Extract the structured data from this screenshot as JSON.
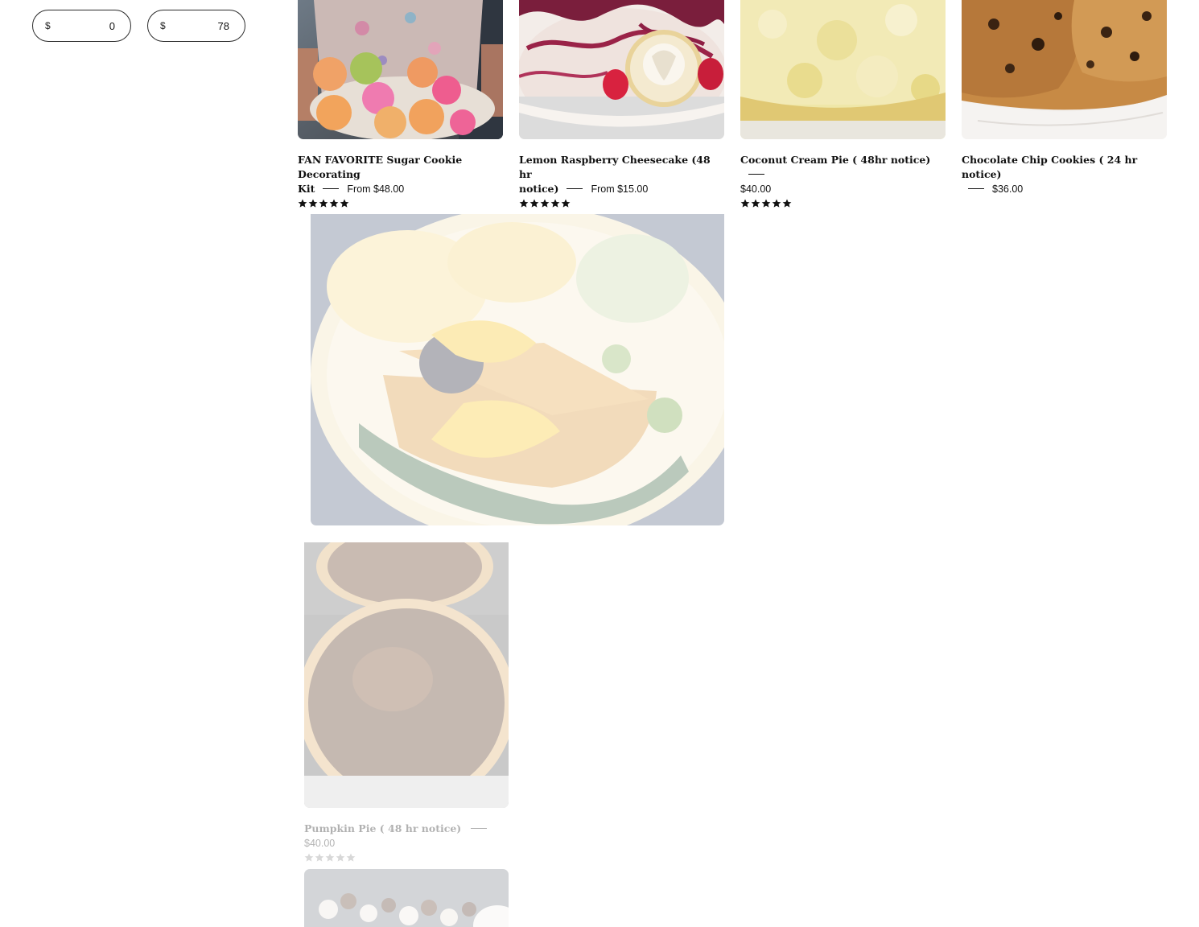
{
  "filter": {
    "currency_symbol": "$",
    "min_value": "0",
    "max_value": "78"
  },
  "products": [
    {
      "title": "FAN FAVORITE Sugar Cookie Decorating",
      "title2": "Kit",
      "price": "From $48.00",
      "rating": 5
    },
    {
      "title": "Lemon Raspberry Cheesecake (48 hr",
      "title2": "notice)",
      "price": "From $15.00",
      "rating": 5
    },
    {
      "title": "Coconut Cream Pie ( 48hr notice)",
      "title2": "",
      "price": "$40.00",
      "rating": 5
    },
    {
      "title": "Chocolate Chip Cookies ( 24 hr notice)",
      "title2": "",
      "price": "$36.00",
      "rating": null
    },
    {
      "title": "Pumpkin Pie ( 48 hr notice)",
      "title2": "",
      "price": "$40.00",
      "rating": 0
    }
  ],
  "colors": {
    "border": "#2b2b2b",
    "text": "#111111",
    "star": "#111111",
    "star_empty": "#888888"
  }
}
